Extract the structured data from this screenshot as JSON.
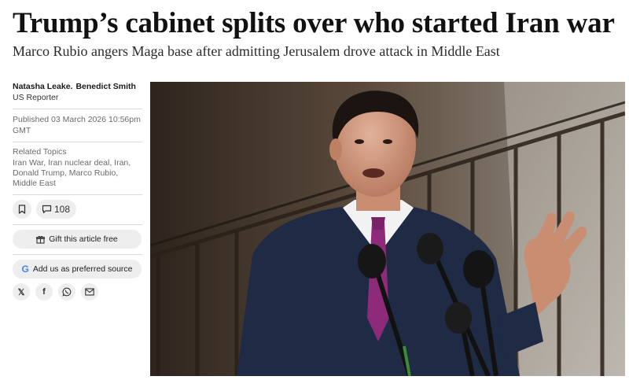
{
  "article": {
    "headline": "Trump’s cabinet splits over who started Iran war",
    "standfirst": "Marco Rubio angers Maga base after admitting Jerusalem drove attack in Middle East"
  },
  "sidebar": {
    "authors": [
      "Natasha Leake.",
      "Benedict Smith"
    ],
    "role": "US Reporter",
    "published": "Published 03 March 2026 10:56pm GMT",
    "topics_title": "Related Topics",
    "topics": "Iran War, Iran nuclear deal, Iran, Donald Trump, Marco Rubio, Middle East",
    "comments_count": "108",
    "gift_label": "Gift this article free",
    "preferred_source_label": "Add us as preferred source",
    "share": [
      {
        "icon": "x-icon",
        "glyph": "𝕏"
      },
      {
        "icon": "facebook-icon",
        "glyph": "f"
      },
      {
        "icon": "whatsapp-icon",
        "glyph": ""
      },
      {
        "icon": "email-icon",
        "glyph": ""
      }
    ]
  },
  "colors": {
    "button_bg": "#eeeeee",
    "text_muted": "#6b6b6b",
    "tie": "#8e2a7a",
    "suit": "#1f2a44"
  }
}
